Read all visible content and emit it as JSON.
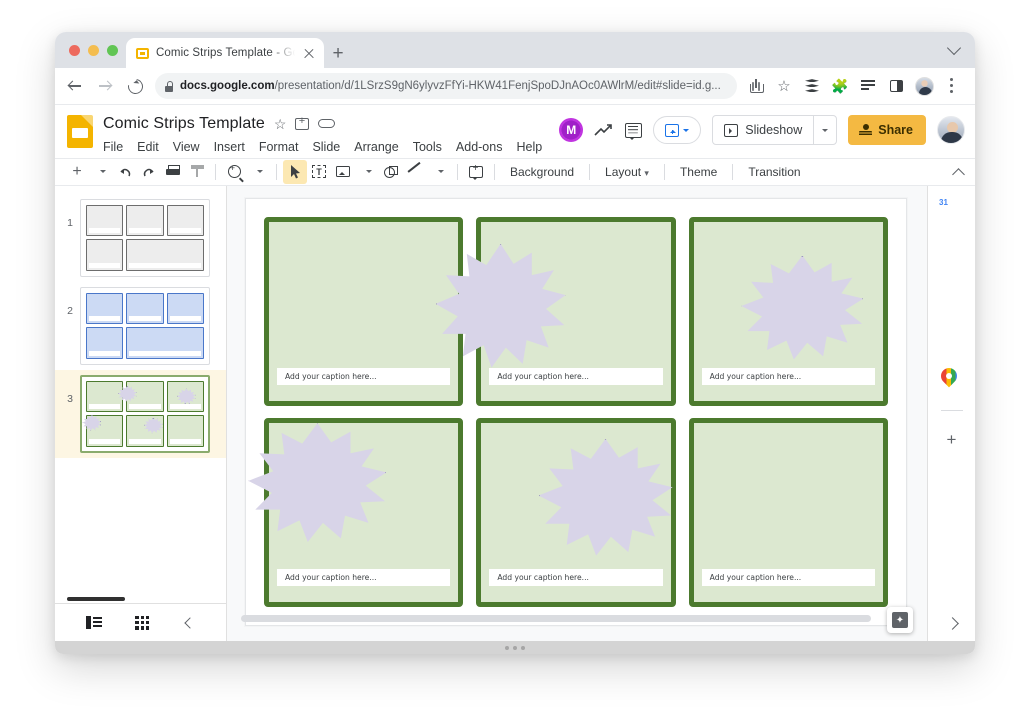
{
  "browser": {
    "tab": {
      "title": "Comic Strips Template - Google Slides",
      "favicon": "slides-favicon"
    },
    "new_tab_label": "+",
    "url": {
      "domain": "docs.google.com",
      "path": "/presentation/d/1LSrzS9gN6ylyvzFfYi-HKW41FenjSpoDJnAOc0AWlrM/edit#slide=id.g..."
    },
    "toolbar_icons": [
      "share-icon",
      "bookmark-star-icon",
      "layers-icon",
      "extensions-puzzle-icon",
      "playlist-icon",
      "side-panel-icon",
      "profile-avatar",
      "browser-menu-kebab-icon"
    ]
  },
  "app": {
    "doc_title": "Comic Strips Template",
    "title_icons": [
      "star-icon",
      "move-to-folder-icon",
      "cloud-saved-icon"
    ],
    "menus": [
      "File",
      "Edit",
      "View",
      "Insert",
      "Format",
      "Slide",
      "Arrange",
      "Tools",
      "Add-ons",
      "Help"
    ],
    "header_right": {
      "mote_label": "M",
      "trend_icon": "activity-trend-icon",
      "comment_icon": "comments-icon",
      "present_icon": "present-to-meet-icon",
      "slideshow_label": "Slideshow",
      "share_label": "Share"
    },
    "toolbar": {
      "icons": [
        "new-slide-icon",
        "undo-icon",
        "redo-icon",
        "print-icon",
        "paint-format-icon",
        "zoom-icon",
        "select-cursor-icon",
        "text-box-icon",
        "insert-image-icon",
        "shape-icon",
        "line-icon",
        "add-comment-icon"
      ],
      "background_label": "Background",
      "layout_label": "Layout",
      "theme_label": "Theme",
      "transition_label": "Transition"
    },
    "filmstrip": {
      "slides": [
        {
          "number": "1",
          "theme": "gray",
          "selected": false,
          "bursts": []
        },
        {
          "number": "2",
          "theme": "blue",
          "selected": false,
          "bursts": []
        },
        {
          "number": "3",
          "theme": "green",
          "selected": true,
          "bursts": [
            1,
            2,
            3,
            4
          ]
        }
      ],
      "footer_icons": [
        "filmstrip-view-icon",
        "grid-view-icon",
        "collapse-filmstrip-icon"
      ]
    },
    "slide": {
      "caption_placeholder": "Add your caption here...",
      "panels": [
        {
          "id": "panel-1",
          "caption": "Add your caption here..."
        },
        {
          "id": "panel-2",
          "caption": "Add your caption here..."
        },
        {
          "id": "panel-3",
          "caption": "Add your caption here..."
        },
        {
          "id": "panel-4",
          "caption": "Add your caption here..."
        },
        {
          "id": "panel-5",
          "caption": "Add your caption here..."
        },
        {
          "id": "panel-6",
          "caption": "Add your caption here..."
        }
      ]
    },
    "explore_icon": "explore-sparkle-icon",
    "right_rail": {
      "icons": [
        "google-calendar-icon",
        "google-keep-icon",
        "google-tasks-icon",
        "google-contacts-icon",
        "google-maps-icon",
        "add-addon-icon",
        "expand-rail-chevron-icon"
      ]
    }
  },
  "colors": {
    "panel_border": "#4c7a2e",
    "panel_fill": "#dce8d0",
    "burst_fill": "#d8d4e8",
    "burst_stroke": "#9a92bd",
    "share_button": "#f4b942",
    "slides_brand": "#f4b400",
    "accent_blue": "#1a73e8"
  }
}
